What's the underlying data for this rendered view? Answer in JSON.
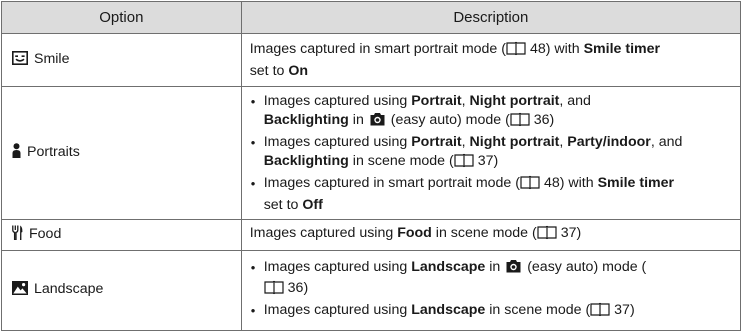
{
  "header": {
    "option": "Option",
    "description": "Description"
  },
  "icons": {
    "smile": "smile-face-icon",
    "portraits": "portrait-person-icon",
    "food": "food-utensils-icon",
    "landscape": "landscape-mountain-icon",
    "manual": "book-reference-icon",
    "easy_auto": "easy-auto-camera-icon"
  },
  "rows": {
    "smile": {
      "option": "Smile",
      "t1": "Images captured in smart portrait mode (",
      "p1": "48",
      "t2": ") with ",
      "b1": "Smile timer",
      "t3": " set to ",
      "b2": "On"
    },
    "portraits": {
      "option": "Portraits",
      "i1": {
        "t1": "Images captured using ",
        "b1": "Portrait",
        "t2": ", ",
        "b2": "Night portrait",
        "t3": ", and ",
        "b3": "Backlighting",
        "t4": " in ",
        "t5": " (easy auto) mode (",
        "p1": "36",
        "t6": ")"
      },
      "i2": {
        "t1": "Images captured using ",
        "b1": "Portrait",
        "t2": ", ",
        "b2": "Night portrait",
        "t3": ", ",
        "b3": "Party/indoor",
        "t4": ", and ",
        "b4": "Backlighting",
        "t5": " in scene mode (",
        "p1": "37",
        "t6": ")"
      },
      "i3": {
        "t1": "Images captured in smart portrait mode (",
        "p1": "48",
        "t2": ") with ",
        "b1": "Smile timer",
        "t3": " set to ",
        "b2": "Off"
      }
    },
    "food": {
      "option": "Food",
      "t1": "Images captured using ",
      "b1": "Food",
      "t2": " in scene mode (",
      "p1": "37",
      "t3": ")"
    },
    "landscape": {
      "option": "Landscape",
      "i1": {
        "t1": "Images captured using ",
        "b1": "Landscape",
        "t2": " in ",
        "t3": " (easy auto) mode (",
        "p1": "36",
        "t4": ")"
      },
      "i2": {
        "t1": "Images captured using ",
        "b1": "Landscape",
        "t2": " in scene mode (",
        "p1": "37",
        "t3": ")"
      }
    }
  }
}
